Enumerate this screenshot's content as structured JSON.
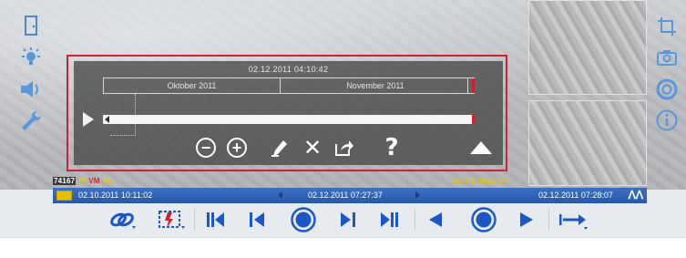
{
  "overlay": {
    "current_timestamp": "02.12.2011 04:10:42",
    "months": [
      "Oktober 2011",
      "November 2011"
    ]
  },
  "status_strip": {
    "camera_id": "74167",
    "flags": [
      "PI",
      "VM",
      "VC"
    ],
    "right_flags": "SD FS REC DY"
  },
  "timebar": {
    "start_time": "02.10.2011 10:11:02",
    "current_time": "02.12.2011 07:27:37",
    "end_time": "02.12.2011 07:28:07"
  },
  "colors": {
    "accent_blue": "#2a58a8",
    "icon_blue": "#1c58c4",
    "highlight_red": "#cc2233",
    "flag_yellow": "#e6c000"
  }
}
